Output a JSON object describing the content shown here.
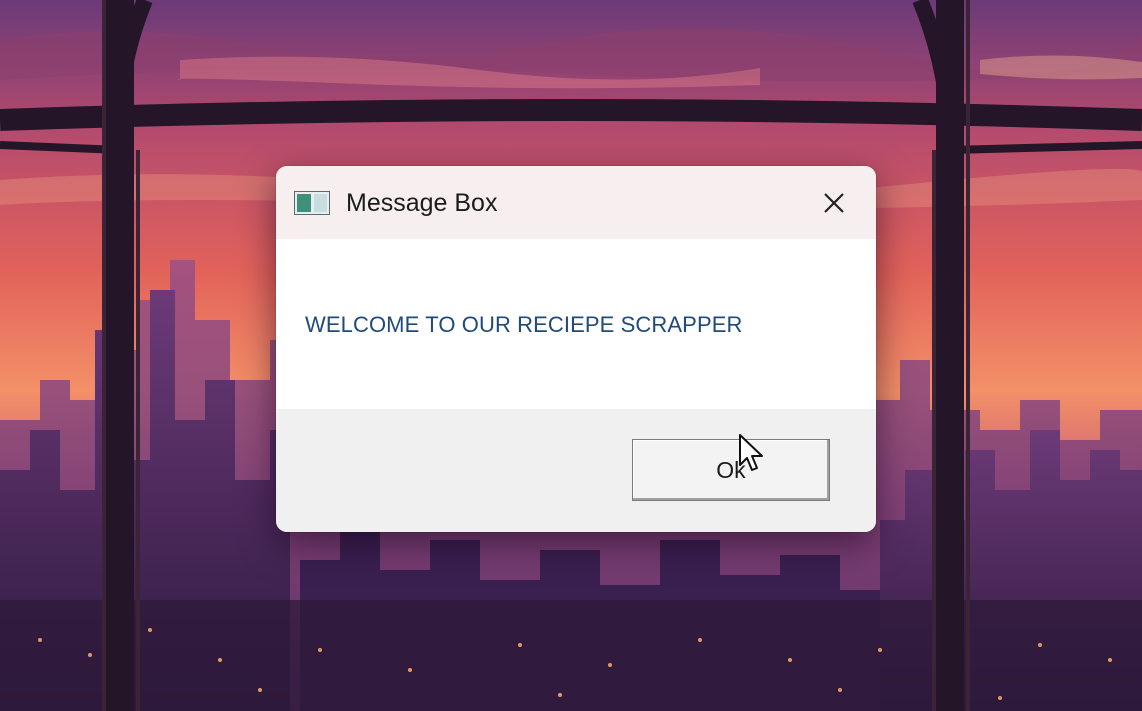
{
  "dialog": {
    "title": "Message Box",
    "message": "WELCOME TO OUR RECIEPE SCRAPPER",
    "ok_label": "Ok",
    "icons": {
      "app": "window-app-icon",
      "close": "close-icon",
      "pointer": "mouse-cursor-icon"
    }
  },
  "colors": {
    "message_text": "#1f4a7a",
    "titlebar_bg": "#f7eef0",
    "footer_bg": "#f0f0f0",
    "sky_top": "#6a3a78",
    "sky_mid": "#e0605a",
    "sky_horizon": "#f6a070"
  }
}
